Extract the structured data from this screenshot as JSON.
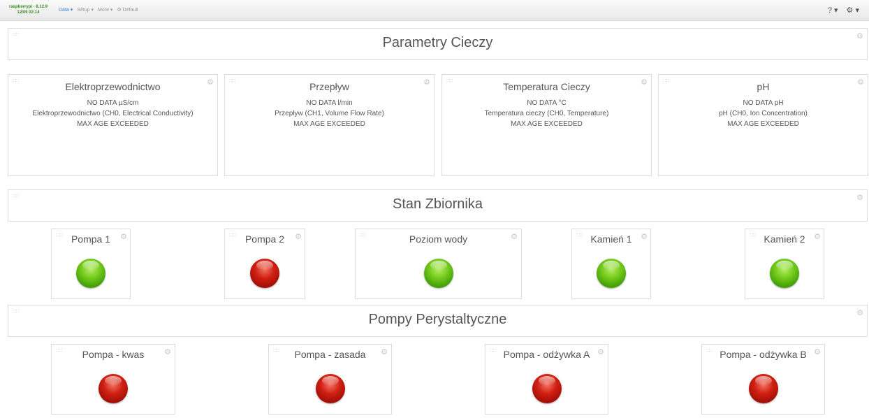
{
  "navbar": {
    "brand_host": "raspberrypi - 8.12.9",
    "brand_time": "12/09 02:14",
    "items": [
      {
        "label": "Data ▾"
      },
      {
        "label": "Setup ▾"
      },
      {
        "label": "More ▾"
      },
      {
        "label": "⚙ Default"
      }
    ],
    "help_label": "? ▾",
    "settings_label": "⚙ ▾"
  },
  "sections": [
    {
      "title": "Parametry Cieczy"
    },
    {
      "title": "Stan Zbiornika"
    },
    {
      "title": "Pompy Perystaltyczne"
    }
  ],
  "measurements": [
    {
      "title": "Elektroprzewodnictwo",
      "value": "NO DATA µS/cm",
      "channel": "Elektroprzewodnictwo (CH0, Electrical Conductivity)",
      "status": "MAX AGE EXCEEDED"
    },
    {
      "title": "Przepływ",
      "value": "NO DATA l/min",
      "channel": "Przepływ (CH1, Volume Flow Rate)",
      "status": "MAX AGE EXCEEDED"
    },
    {
      "title": "Temperatura Cieczy",
      "value": "NO DATA °C",
      "channel": "Temperatura cieczy (CH0, Temperature)",
      "status": "MAX AGE EXCEEDED"
    },
    {
      "title": "pH",
      "value": "NO DATA pH",
      "channel": "pH (CH0, Ion Concentration)",
      "status": "MAX AGE EXCEEDED"
    }
  ],
  "tank": [
    {
      "title": "Pompa 1",
      "state": "green"
    },
    {
      "title": "Pompa 2",
      "state": "red"
    },
    {
      "title": "Poziom wody",
      "state": "green"
    },
    {
      "title": "Kamień 1",
      "state": "green"
    },
    {
      "title": "Kamień 2",
      "state": "green"
    }
  ],
  "pumps": [
    {
      "title": "Pompa - kwas",
      "state": "red"
    },
    {
      "title": "Pompa - zasada",
      "state": "red"
    },
    {
      "title": "Pompa - odżywka A",
      "state": "red"
    },
    {
      "title": "Pompa - odżywka B",
      "state": "red"
    }
  ],
  "colors": {
    "on": "#5cb814",
    "off": "#c0180c",
    "brand": "#3a8a1f",
    "nav_active": "#3b83d3"
  }
}
